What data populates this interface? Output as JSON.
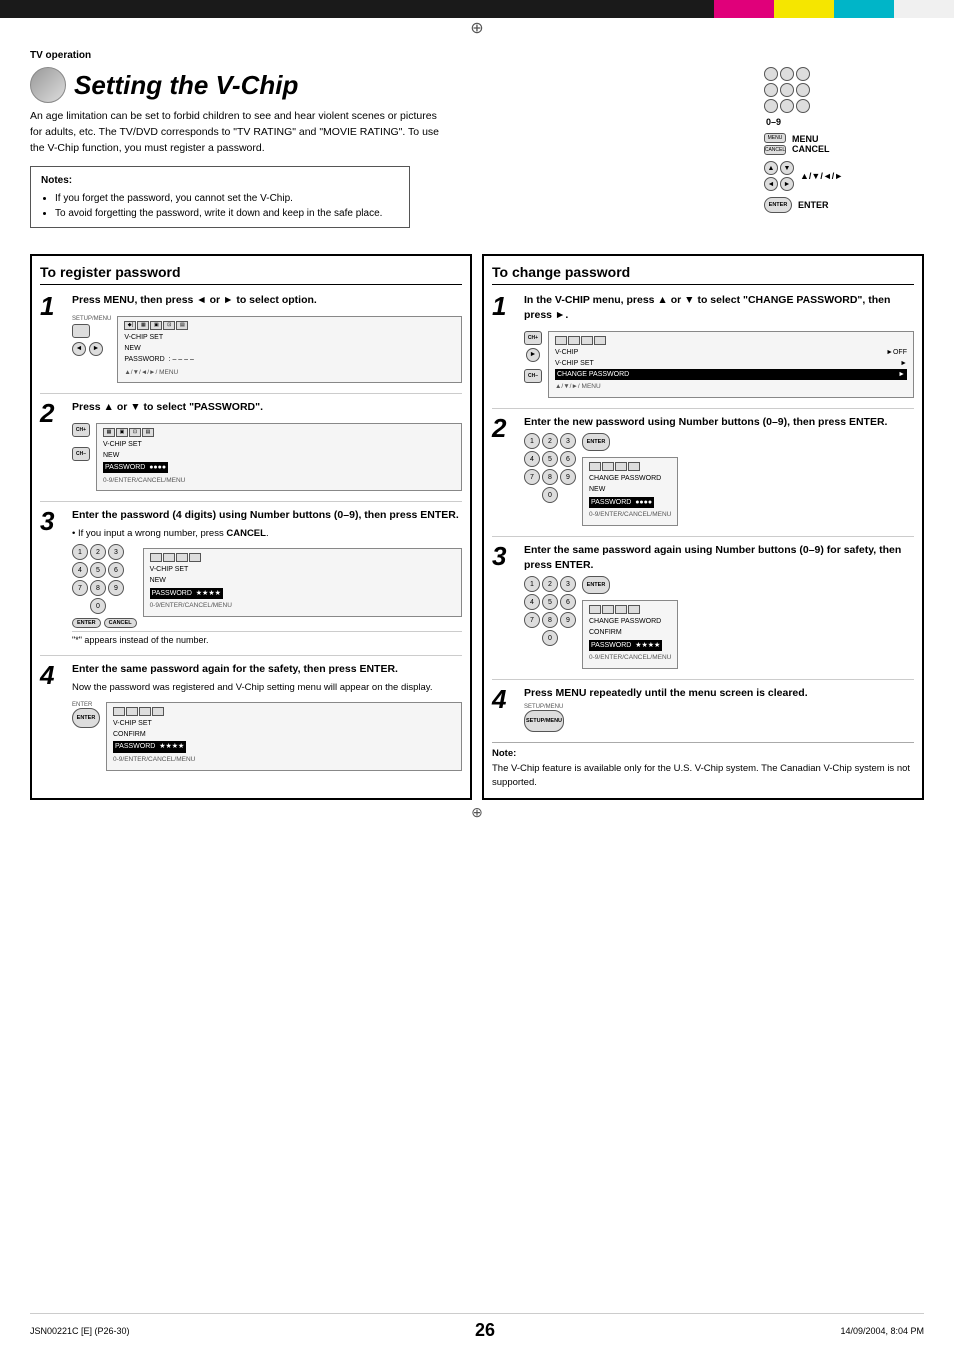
{
  "page": {
    "top_bar_colors": [
      "#1a1a1a",
      "#e0007a",
      "#f5e600",
      "#00b5c8",
      "#f0f0f0"
    ],
    "section_label": "TV operation",
    "title": "Setting the V-Chip",
    "intro_text": "An age limitation can be set to forbid children to see and hear violent scenes or pictures for adults, etc. The TV/DVD corresponds to \"TV RATING\" and \"MOVIE RATING\". To use the V-Chip function, you must register a password.",
    "notes": {
      "title": "Notes:",
      "items": [
        "If you forget the password, you cannot set the V-Chip.",
        "To avoid forgetting the password, write it down and keep in the safe place."
      ]
    },
    "remote_labels": {
      "zero_to_nine": "0–9",
      "menu_cancel": "MENU\nCANCEL",
      "nav": "▲/▼/◄/►",
      "enter": "ENTER"
    },
    "left_col": {
      "header": "To register password",
      "steps": [
        {
          "number": "1",
          "title": "Press MENU, then press ◄ or ► to select  option.",
          "screen": {
            "top_label": "SETUP/MENU",
            "icons": [
              "◆|▲",
              "▦",
              "▣",
              "⊡",
              "▤"
            ],
            "rows": [
              {
                "label": "",
                "value": "V-CHIP SET"
              },
              {
                "label": "NEW",
                "value": ""
              },
              {
                "label": "PASSWORD",
                "value": ": – – – –"
              }
            ],
            "nav_label": "▲/▼/◄/►/ MENU"
          }
        },
        {
          "number": "2",
          "title": "Press ▲ or ▼ to select \"PASSWORD\".",
          "screen": {
            "top_label": "",
            "rows": [
              {
                "label": "",
                "value": "V-CHIP SET"
              },
              {
                "label": "NEW",
                "value": ""
              },
              {
                "label": "PASSWORD",
                "value": "●●●●",
                "highlight": true
              }
            ],
            "nav_label": "0-9/ENTER/CANCEL/MENU"
          }
        },
        {
          "number": "3",
          "title": "Enter the password (4 digits) using Number buttons (0–9), then press ENTER.",
          "sub": "• If you input a wrong number, press CANCEL.",
          "screen": {
            "rows": [
              {
                "label": "",
                "value": "V-CHIP SET"
              },
              {
                "label": "NEW",
                "value": ""
              },
              {
                "label": "PASSWORD",
                "value": "★★★★",
                "highlight": true
              }
            ],
            "nav_label": "0-9/ENTER/CANCEL/MENU"
          },
          "note": "\"*\" appears instead of the number.",
          "has_enter_cancel": true
        },
        {
          "number": "4",
          "title": "Enter the same password again for the safety, then press ENTER.",
          "sub": "Now the password was registered and V-Chip setting menu will appear on the display.",
          "screen": {
            "rows": [
              {
                "label": "",
                "value": "V-CHIP SET"
              },
              {
                "label": "CONFIRM",
                "value": ""
              },
              {
                "label": "PASSWORD",
                "value": "★★★★",
                "highlight": true
              }
            ],
            "nav_label": "0-9/ENTER/CANCEL/MENU"
          }
        }
      ]
    },
    "right_col": {
      "header": "To change password",
      "steps": [
        {
          "number": "1",
          "title": "In the V-CHIP menu, press ▲ or ▼ to select \"CHANGE PASSWORD\", then press ►.",
          "screen": {
            "rows": [
              {
                "label": "V-CHIP",
                "value": "►OFF"
              },
              {
                "label": "V-CHIP SET",
                "value": "►"
              },
              {
                "label": "CHANGE PASSWORD",
                "value": "►",
                "highlight": true
              }
            ],
            "nav_label": "▲/▼/►/ MENU"
          }
        },
        {
          "number": "2",
          "title": "Enter the new password using Number buttons (0–9), then press ENTER.",
          "screen": {
            "rows": [
              {
                "label": "",
                "value": "CHANGE PASSWORD"
              },
              {
                "label": "NEW",
                "value": ""
              },
              {
                "label": "PASSWORD",
                "value": "●●●●",
                "highlight": true
              }
            ],
            "nav_label": "0-9/ENTER/CANCEL/MENU"
          }
        },
        {
          "number": "3",
          "title": "Enter the same password again using Number buttons (0–9) for safety, then press ENTER.",
          "screen": {
            "rows": [
              {
                "label": "",
                "value": "CHANGE PASSWORD"
              },
              {
                "label": "CONFIRM",
                "value": ""
              },
              {
                "label": "PASSWORD",
                "value": "★★★★",
                "highlight": true
              }
            ],
            "nav_label": "0-9/ENTER/CANCEL/MENU"
          }
        },
        {
          "number": "4",
          "title": "Press MENU repeatedly until the menu screen is cleared.",
          "setup_btn": "SETUP/MENU"
        }
      ],
      "note": {
        "title": "Note:",
        "text": "The V-Chip feature is available only for the U.S. V-Chip system. The Canadian V-Chip system is not supported."
      }
    }
  },
  "footer": {
    "page_num": "26",
    "left_text": "JSN00221C [E] (P26-30)",
    "center_text": "26",
    "right_text": "14/09/2004, 8:04 PM"
  }
}
